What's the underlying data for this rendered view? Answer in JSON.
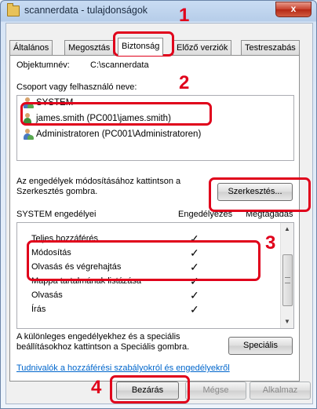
{
  "window": {
    "title": "scannerdata - tulajdonságok",
    "close_label": "x"
  },
  "tabs": [
    {
      "label": "Általános"
    },
    {
      "label": "Megosztás"
    },
    {
      "label": "Biztonság"
    },
    {
      "label": "Előző verziók"
    },
    {
      "label": "Testreszabás"
    }
  ],
  "security": {
    "object_name_label": "Objektumnév:",
    "object_name_value": "C:\\scannerdata",
    "group_label": "Csoport vagy felhasználó neve:",
    "users": [
      {
        "name": "SYSTEM"
      },
      {
        "name": "james.smith (PC001\\james.smith)"
      },
      {
        "name": "Administratoren (PC001\\Administratoren)"
      }
    ],
    "edit_hint": "Az engedélyek módosításához kattintson a Szerkesztés gombra.",
    "edit_button": "Szerkesztés...",
    "perm_header": "SYSTEM engedélyei",
    "allow_header": "Engedélyezés",
    "deny_header": "Megtagadás",
    "permissions": [
      {
        "name": "Teljes hozzáférés",
        "allow": "✓"
      },
      {
        "name": "Módosítás",
        "allow": "✓"
      },
      {
        "name": "Olvasás és végrehajtás",
        "allow": "✓"
      },
      {
        "name": "Mappa tartalmának listázása",
        "allow": "✓"
      },
      {
        "name": "Olvasás",
        "allow": "✓"
      },
      {
        "name": "Írás",
        "allow": "✓"
      }
    ],
    "special_hint": "A különleges engedélyekhez és a speciális beállításokhoz kattintson a Speciális gombra.",
    "special_button": "Speciális",
    "help_link": "Tudnivalók a hozzáférési szabályokról és engedélyekről"
  },
  "footer": {
    "close_button": "Bezárás",
    "cancel_button": "Mégse",
    "apply_button": "Alkalmaz"
  },
  "steps": [
    "1",
    "2",
    "3",
    "4"
  ],
  "colors": {
    "highlight": "#e0001b",
    "link": "#0066cc"
  }
}
